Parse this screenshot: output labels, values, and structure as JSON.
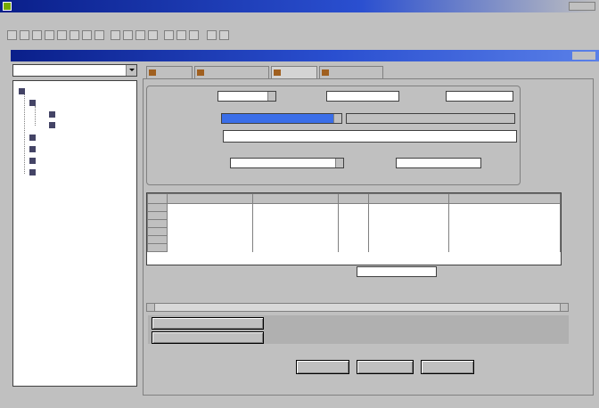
{
  "window": {
    "title": ""
  },
  "menu": [
    "",
    "",
    "",
    "",
    "",
    "",
    "",
    "",
    "",
    "",
    "",
    "",
    "",
    "",
    "",
    ""
  ],
  "inner_window": {
    "title": ""
  },
  "nav": {
    "combo_value": "",
    "tree": [
      {
        "label": "",
        "level": 0
      },
      {
        "label": "",
        "level": 1
      },
      {
        "label": "",
        "level": 2
      },
      {
        "label": "",
        "level": 2
      },
      {
        "label": "",
        "level": 1
      },
      {
        "label": "",
        "level": 1
      },
      {
        "label": "",
        "level": 1
      },
      {
        "label": "",
        "level": 1
      }
    ]
  },
  "tabs": [
    "",
    "",
    "",
    ""
  ],
  "form": {
    "row1_label": "",
    "row1_value": "",
    "row1_label2": "",
    "row1_value2": "",
    "row1_label3": "",
    "row1_value3": "",
    "row2_label": "",
    "row2_value": "",
    "row3_label": "",
    "row3_value": "",
    "row4_label": "",
    "row4_value": "",
    "row4_label2": "",
    "row4_value2": ""
  },
  "grid": {
    "headers": [
      "",
      "",
      "",
      "",
      "",
      ""
    ],
    "rows": [
      [
        "",
        "",
        "",
        "",
        "",
        ""
      ],
      [
        "",
        "",
        "",
        "",
        "",
        ""
      ],
      [
        "",
        "",
        "",
        "",
        "",
        ""
      ],
      [
        "",
        "",
        "",
        "",
        "",
        ""
      ],
      [
        "",
        "",
        "",
        "",
        "",
        ""
      ],
      [
        "",
        "",
        "",
        "",
        "",
        ""
      ]
    ]
  },
  "total": {
    "label": "",
    "value": ""
  },
  "side_buttons": [
    "",
    ""
  ],
  "bottom_buttons": [
    "",
    "",
    ""
  ]
}
